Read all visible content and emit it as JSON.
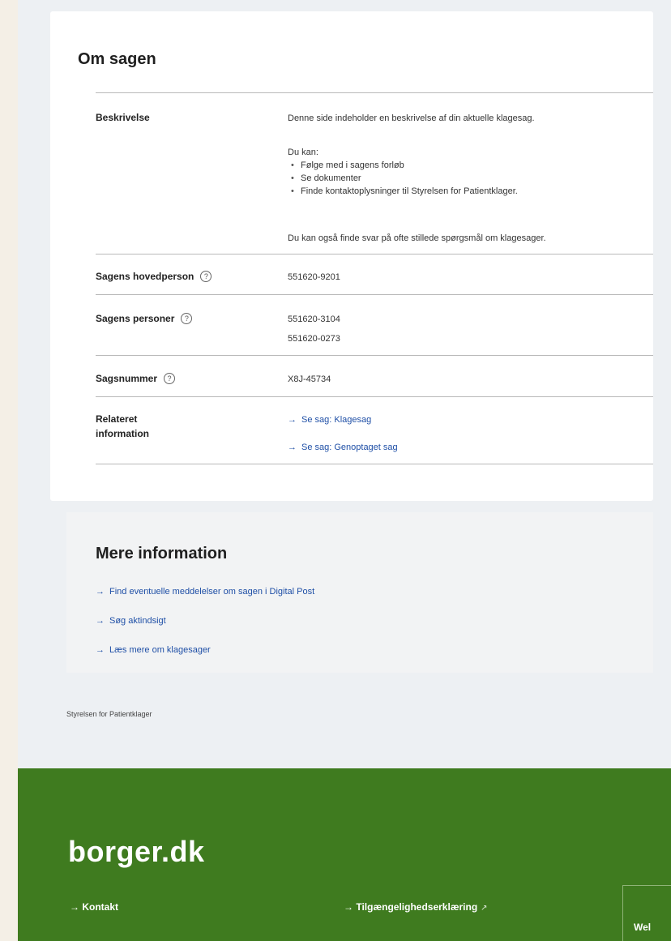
{
  "case": {
    "title": "Om sagen",
    "rows": {
      "description": {
        "label": "Beskrivelse",
        "intro": "Denne side indeholder en beskrivelse af din aktuelle klagesag.",
        "you_can": "Du kan:",
        "bullets": [
          "Følge med i sagens forløb",
          "Se dokumenter",
          "Finde kontaktoplysninger til Styrelsen for Patientklager."
        ],
        "outro": "Du kan også finde svar på ofte stillede spørgsmål om klagesager."
      },
      "main_person": {
        "label": "Sagens hovedperson",
        "help_icon": "?",
        "value": "551620-9201"
      },
      "persons": {
        "label": "Sagens personer",
        "help_icon": "?",
        "values": [
          "551620-3104",
          "551620-0273"
        ]
      },
      "case_number": {
        "label": "Sagsnummer",
        "help_icon": "?",
        "value": "X8J-45734"
      },
      "related": {
        "label_line1": "Relateret",
        "label_line2": "information",
        "links": [
          "Se sag: Klagesag",
          "Se sag: Genoptaget sag"
        ]
      }
    }
  },
  "more_info": {
    "title": "Mere information",
    "links": [
      "Find eventuelle meddelelser om sagen i Digital Post",
      "Søg aktindsigt",
      "Læs mere om klagesager"
    ]
  },
  "footer_note": "Styrelsen for Patientklager",
  "footer": {
    "brand": "borger.dk",
    "links": [
      "Kontakt",
      "Tilgængelighedserklæring"
    ],
    "partial_box_text": "Wel"
  },
  "icons": {
    "arrow": "→",
    "external": "↗"
  },
  "colors": {
    "footer_green": "#3f7b1f",
    "link_blue": "#1f4fa6"
  }
}
